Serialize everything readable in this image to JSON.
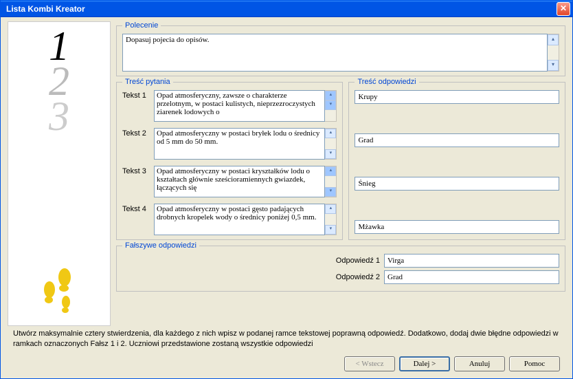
{
  "window": {
    "title": "Lista Kombi Kreator"
  },
  "polecenie": {
    "legend": "Polecenie",
    "text": "Dopasuj pojecia do opisów."
  },
  "tresc_pytania": {
    "legend": "Treść pytania",
    "rows": [
      {
        "label": "Tekst 1",
        "text": "Opad atmosferyczny, zawsze o charakterze przelotnym, w postaci kulistych, nieprzezroczystych ziarenek lodowych o"
      },
      {
        "label": "Tekst 2",
        "text": "Opad atmosferyczny w postaci bryłek lodu o średnicy od 5 mm do 50 mm."
      },
      {
        "label": "Tekst 3",
        "text": "Opad atmosferyczny w postaci kryształków lodu o kształtach głównie sześcioramiennych gwiazdek, łączących się"
      },
      {
        "label": "Tekst 4",
        "text": "Opad atmosferyczny w postaci gęsto padających drobnych kropelek wody o średnicy poniżej 0,5 mm."
      }
    ]
  },
  "tresc_odpowiedzi": {
    "legend": "Treść odpowiedzi",
    "answers": [
      "Krupy",
      "Grad",
      "Śnieg",
      "Mżawka"
    ]
  },
  "falszywe": {
    "legend": "Fałszywe odpowiedzi",
    "rows": [
      {
        "label": "Odpowiedź 1",
        "value": "Virga"
      },
      {
        "label": "Odpowiedź 2",
        "value": "Grad"
      }
    ]
  },
  "instructions": "Utwórz maksymalnie cztery stwierdzenia, dla każdego z nich wpisz w podanej ramce tekstowej poprawną odpowiedź. Dodatkowo, dodaj dwie błędne odpowiedzi w ramkach oznaczonych Fałsz 1 i 2. Uczniowi przedstawione zostaną wszystkie odpowiedzi",
  "buttons": {
    "back": "< Wstecz",
    "next": "Dalej >",
    "cancel": "Anuluj",
    "help": "Pomoc"
  },
  "sidebar": {
    "n1": "1",
    "n2": "2",
    "n3": "3"
  }
}
